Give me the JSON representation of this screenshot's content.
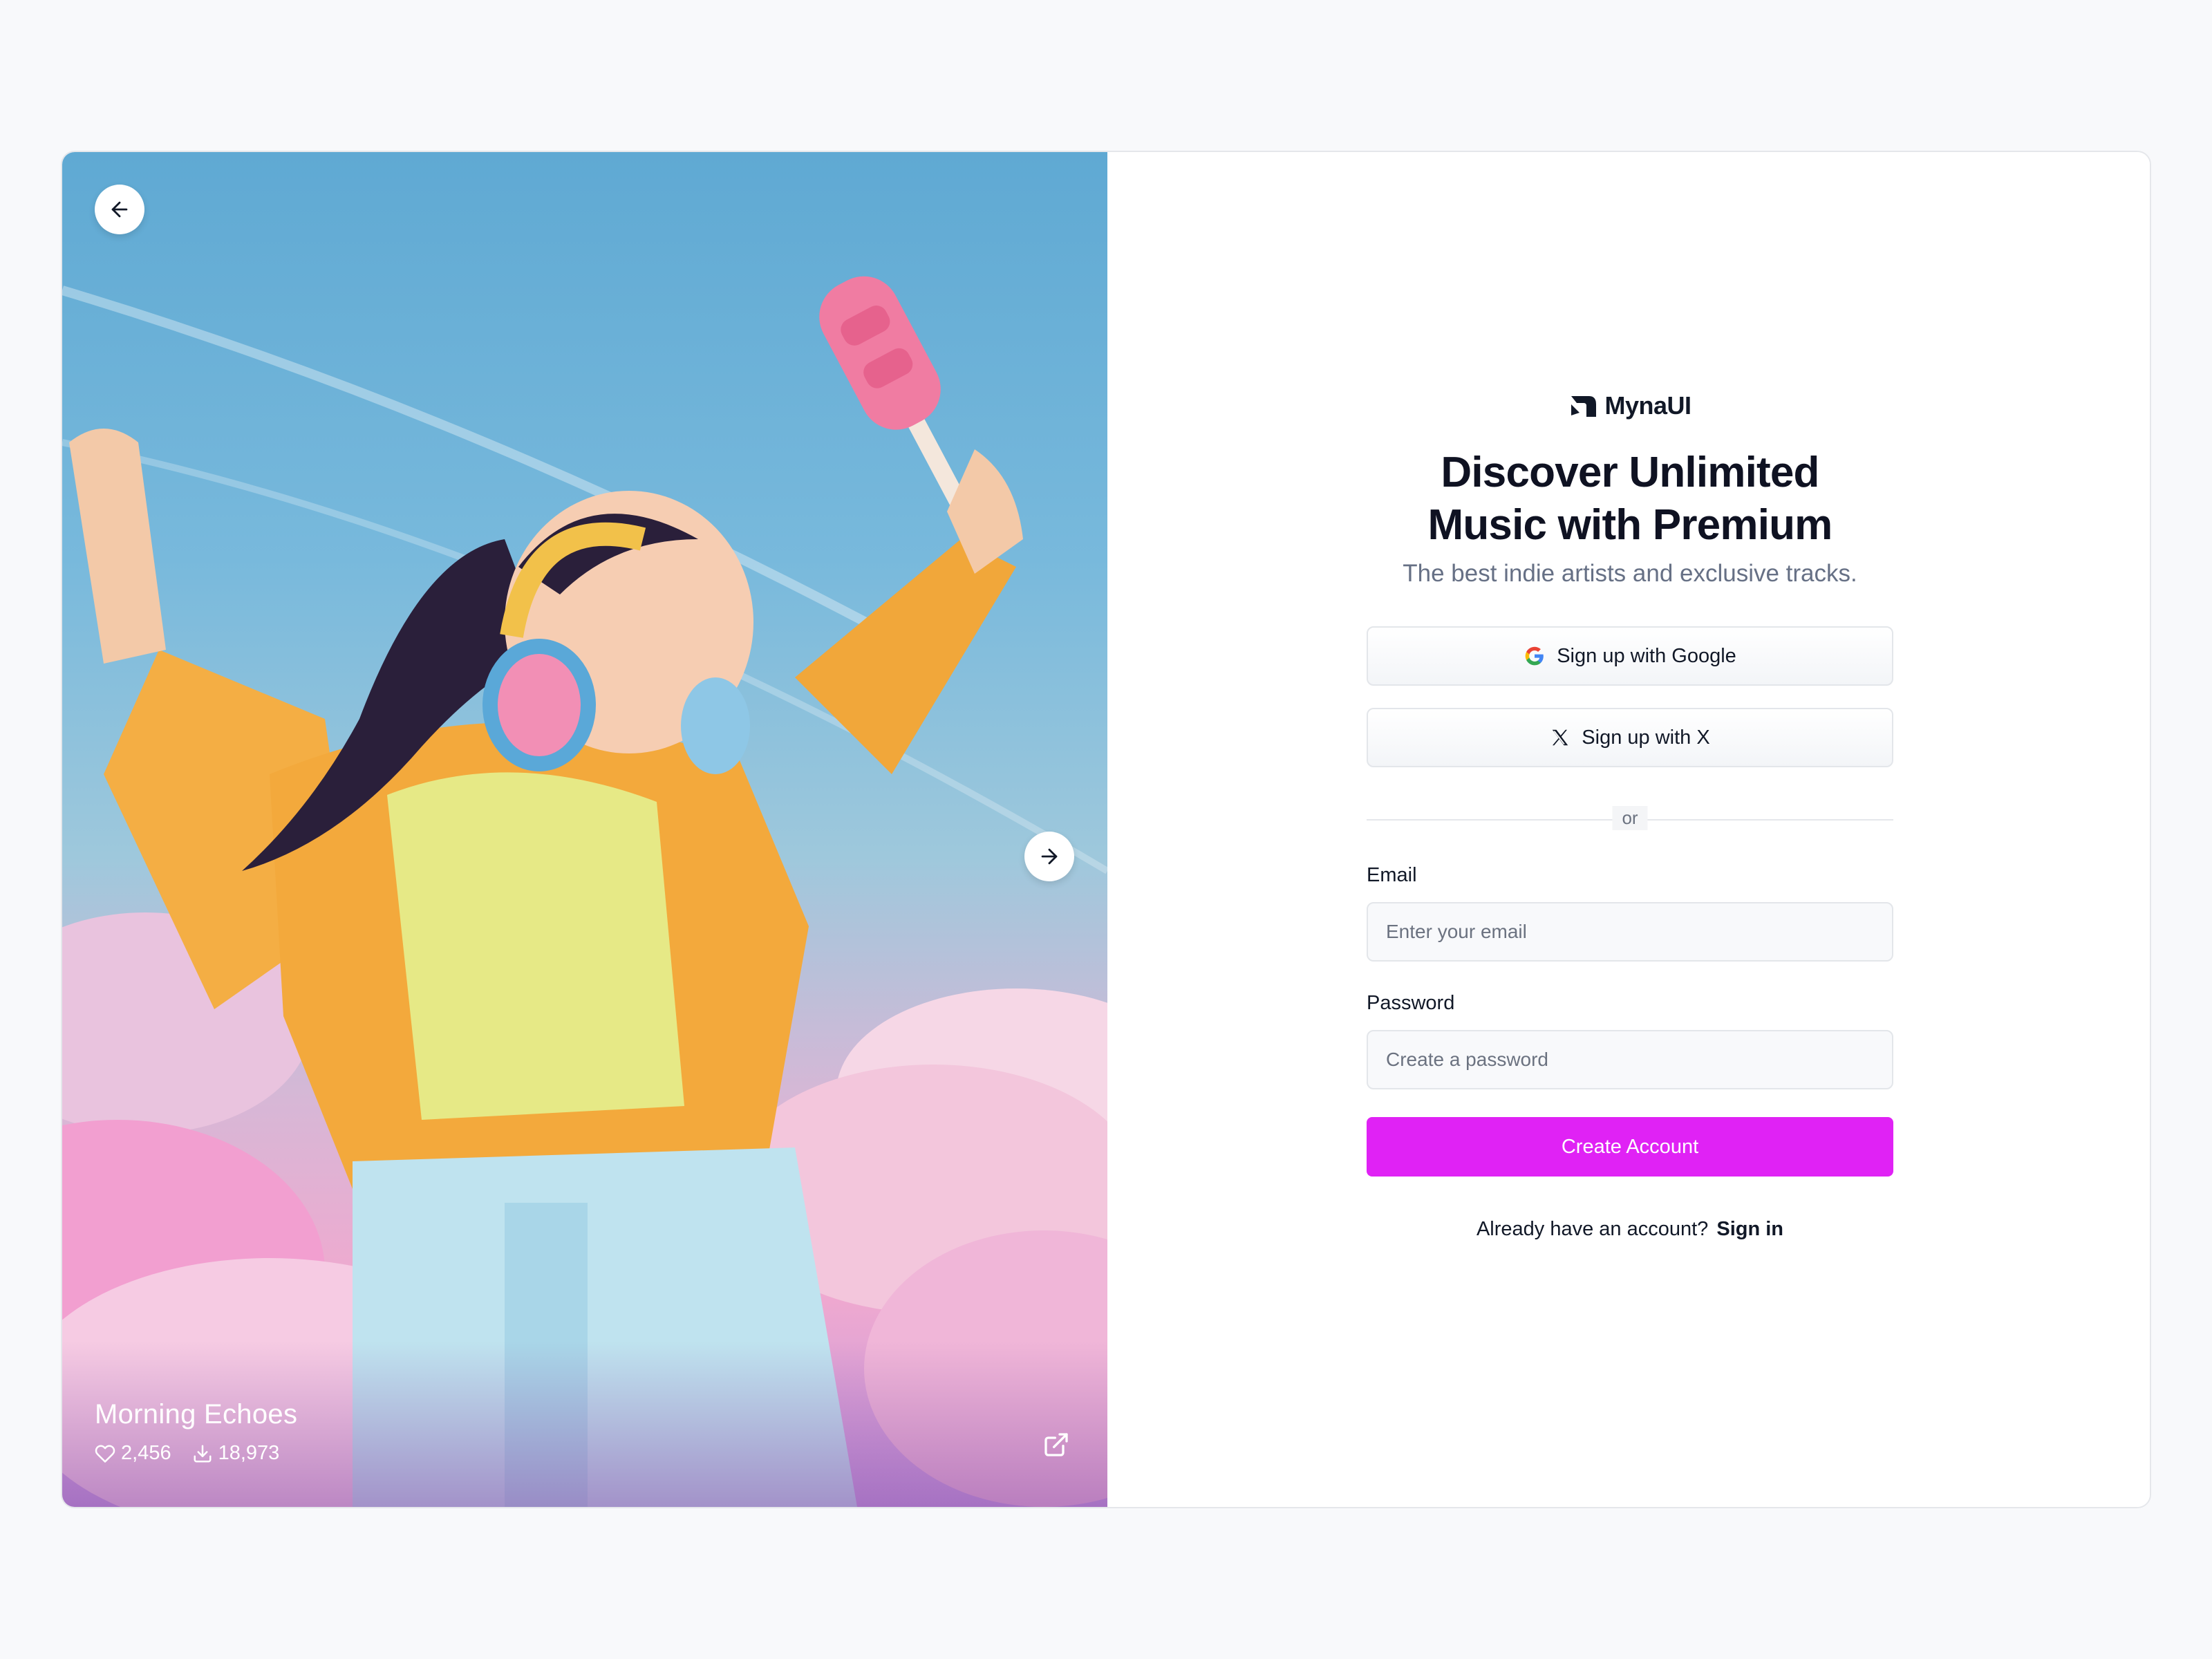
{
  "hero": {
    "track_title": "Morning Echoes",
    "likes": "2,456",
    "downloads": "18,973"
  },
  "brand": {
    "name": "MynaUI"
  },
  "form": {
    "headline_line1": "Discover Unlimited",
    "headline_line2": "Music with Premium",
    "subheadline": "The best indie artists and exclusive tracks.",
    "google_button": "Sign up with Google",
    "x_button": "Sign up with X",
    "divider_text": "or",
    "email_label": "Email",
    "email_placeholder": "Enter your email",
    "password_label": "Password",
    "password_placeholder": "Create a password",
    "submit_button": "Create Account",
    "signin_prompt": "Already have an account?",
    "signin_link": "Sign in"
  },
  "colors": {
    "accent": "#e022f5",
    "page_background": "#f8f9fb"
  },
  "icons": {
    "prev": "arrow-left-icon",
    "next": "arrow-right-icon",
    "likes": "heart-icon",
    "downloads": "download-icon",
    "external": "external-link-icon",
    "google": "google-icon",
    "x": "x-logo-icon"
  }
}
